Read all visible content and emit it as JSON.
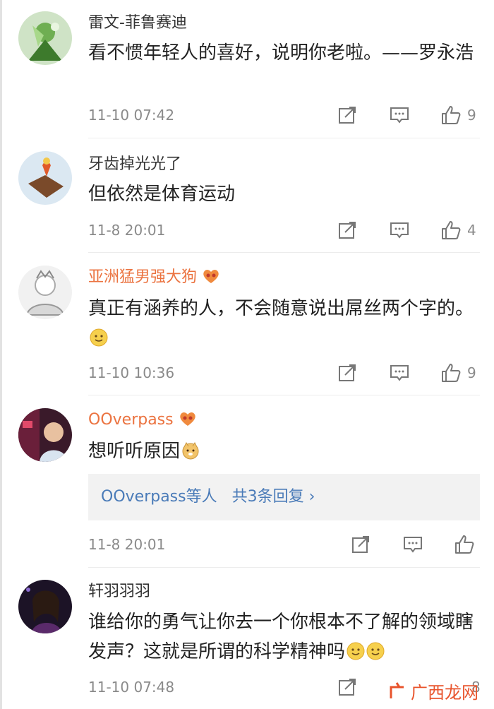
{
  "colors": {
    "vip_name": "#eb7340",
    "link": "#4a7bb8",
    "meta": "#8a8a8a",
    "text": "#222222"
  },
  "comments": [
    {
      "username": "雷文-菲鲁赛迪",
      "text": "看不惯年轻人的喜好，说明你老啦。——罗永浩",
      "time": "11-10 07:42",
      "likes": "9",
      "avatar": "green-fantasy-character-avatar"
    },
    {
      "username": "牙齿掉光光了",
      "text": "但依然是体育运动",
      "time": "11-8 20:01",
      "likes": "4",
      "avatar": "cartoon-boat-avatar"
    },
    {
      "username": "亚洲猛男强大狗",
      "text": "真正有涵养的人，不会随意说出屌丝两个字的。",
      "time": "11-10 10:36",
      "likes": "9",
      "badge": "vip-heart-badge",
      "emoji": "smile-emoji",
      "avatar": "sketch-character-avatar"
    },
    {
      "username": "OOverpass",
      "text": "想听听原因",
      "time": "11-8 20:01",
      "likes": "",
      "badge": "vip-heart-badge",
      "emoji": "doge-emoji",
      "avatar": "person-photo-avatar",
      "replies": {
        "users": "OOverpass等人",
        "more": "共3条回复",
        "chevron": "›"
      }
    },
    {
      "username": "轩羽羽羽",
      "text": "谁给你的勇气让你去一个你根本不了解的领域瞎发声？这就是所谓的科学精神吗",
      "time": "11-10 07:48",
      "likes": "8",
      "emoji": "smile-emoji",
      "avatar": "dark-portrait-avatar"
    }
  ],
  "icons": {
    "share": "share-icon",
    "comment": "comment-icon",
    "like": "thumbs-up-icon"
  },
  "watermark": {
    "text": "广西龙网"
  }
}
